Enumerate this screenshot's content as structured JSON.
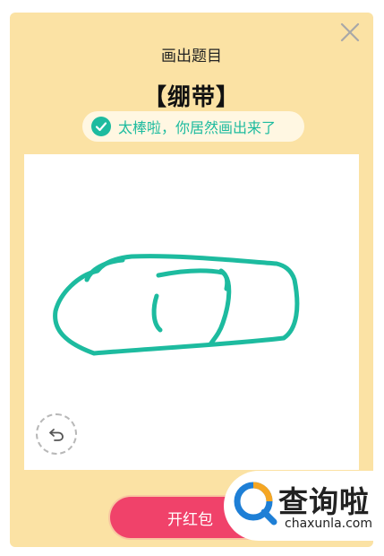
{
  "dialog": {
    "hint": "画出题目",
    "word": "【绷带】",
    "success_message": "太棒啦，你居然画出来了",
    "red_packet_label": "开红包"
  },
  "icons": {
    "close": "close-icon",
    "success": "check-circle-icon",
    "undo": "undo-icon"
  },
  "colors": {
    "modal_bg": "#fbe2a4",
    "accent_green": "#1dbb9f",
    "button_red": "#f0426a"
  },
  "watermark": {
    "name": "查询啦",
    "domain": "chaxunla.com"
  }
}
